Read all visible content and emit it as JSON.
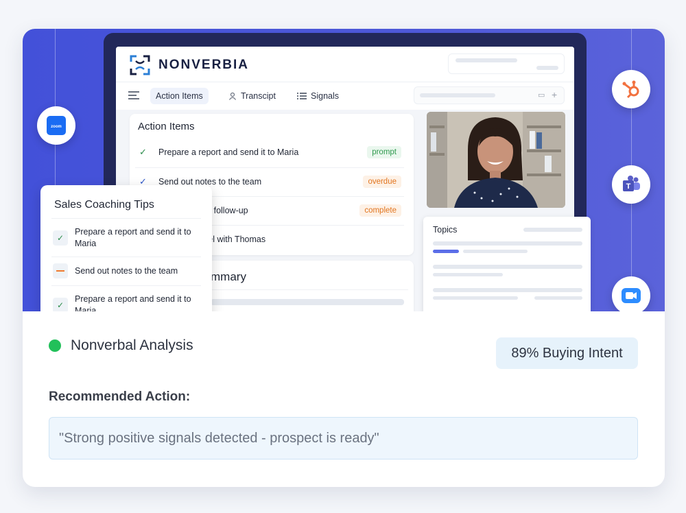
{
  "app": {
    "brand": "NONVERBIA",
    "tabs": [
      "Action Items",
      "Transcipt",
      "Signals"
    ]
  },
  "action_items": {
    "title": "Action Items",
    "rows": [
      {
        "text": "Prepare a report and send it to Maria",
        "tag": "prompt",
        "tag_color": "#2f9a4e",
        "tag_bg": "#eaf7ee"
      },
      {
        "text": "Send out notes to the team",
        "tag": "overdue",
        "tag_color": "#e2751f",
        "tag_bg": "#fdf1e6"
      },
      {
        "text": "schedule next follow-up",
        "tag": "complete",
        "tag_color": "#e2751f",
        "tag_bg": "#fdf1e6"
      },
      {
        "text": "forecast model with Thomas",
        "tag": ""
      }
    ]
  },
  "summary": {
    "title_partial": "mmary"
  },
  "topics": {
    "title": "Topics"
  },
  "coaching": {
    "title": "Sales Coaching Tips",
    "items": [
      {
        "text": "Prepare a report and send it to Maria",
        "state": "check"
      },
      {
        "text": "Send out notes to the team",
        "state": "dash"
      },
      {
        "text": "Prepare a report and send it to Maria",
        "state": "check"
      }
    ]
  },
  "integrations": [
    "zoom-icon",
    "hubspot-icon",
    "teams-icon",
    "video-call-icon"
  ],
  "analysis": {
    "label": "Nonverbal Analysis",
    "intent": "89% Buying Intent",
    "recommended_label": "Recommended Action:",
    "recommended_text": "\"Strong positive signals detected - prospect is ready\""
  },
  "colors": {
    "hero": "#4351d9",
    "accent": "#5b6ee8",
    "status": "#22c05a",
    "intent_bg": "#e6f2fb"
  }
}
